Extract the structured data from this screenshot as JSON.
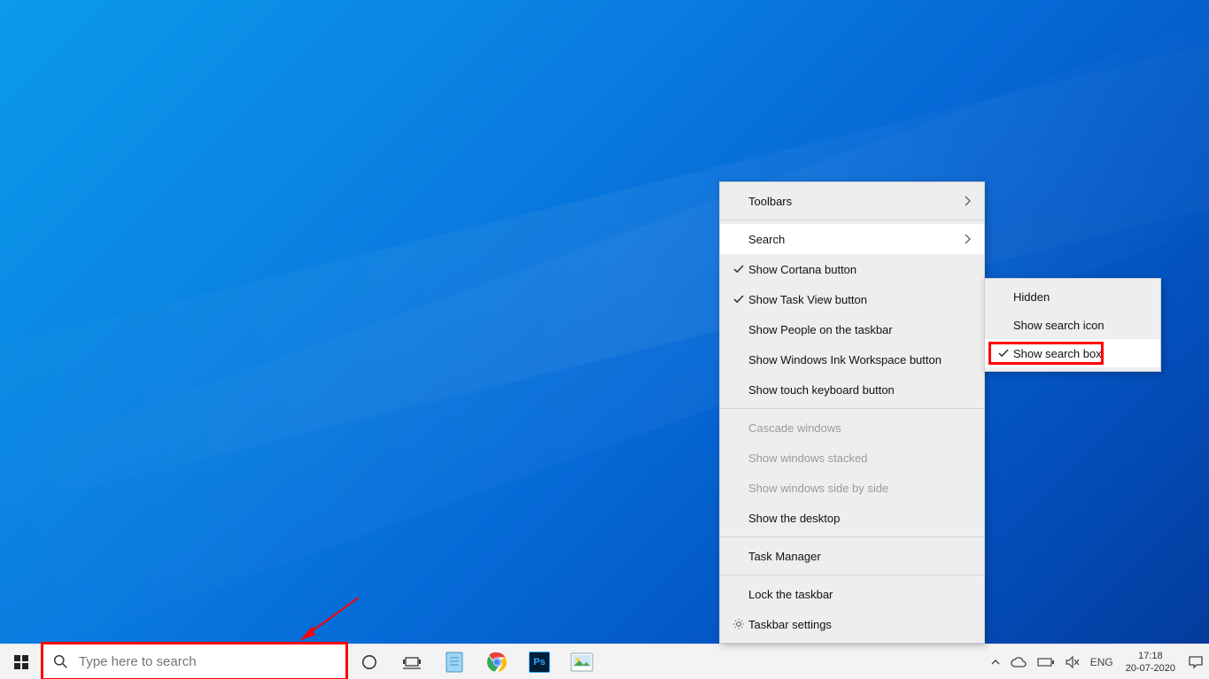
{
  "search": {
    "placeholder": "Type here to search"
  },
  "contextMenu": {
    "items": {
      "toolbars": "Toolbars",
      "search": "Search",
      "cortana": "Show Cortana button",
      "taskview": "Show Task View button",
      "people": "Show People on the taskbar",
      "ink": "Show Windows Ink Workspace button",
      "touchkb": "Show touch keyboard button",
      "cascade": "Cascade windows",
      "stacked": "Show windows stacked",
      "sidebyside": "Show windows side by side",
      "showdesktop": "Show the desktop",
      "taskmgr": "Task Manager",
      "lock": "Lock the taskbar",
      "settings": "Taskbar settings"
    }
  },
  "submenu": {
    "hidden": "Hidden",
    "icon": "Show search icon",
    "box": "Show search box"
  },
  "tray": {
    "lang": "ENG",
    "time": "17:18",
    "date": "20-07-2020"
  }
}
